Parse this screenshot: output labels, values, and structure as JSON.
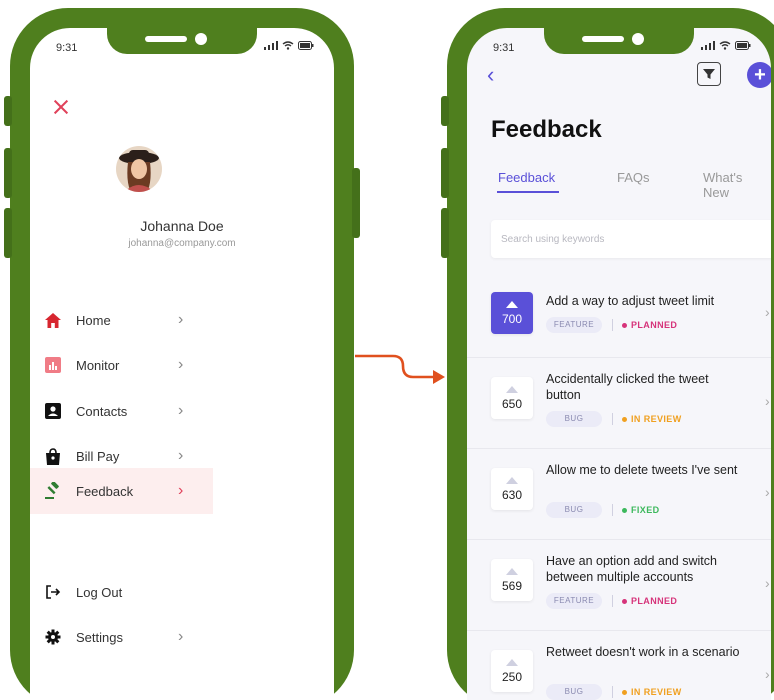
{
  "left_phone": {
    "status_time": "9:31",
    "profile": {
      "name": "Johanna Doe",
      "email": "johanna@company.com"
    },
    "menu": [
      {
        "label": "Home",
        "icon": "home-icon"
      },
      {
        "label": "Monitor",
        "icon": "bar-chart-icon"
      },
      {
        "label": "Contacts",
        "icon": "contacts-icon"
      },
      {
        "label": "Bill Pay",
        "icon": "shopping-bag-icon"
      },
      {
        "label": "Feedback",
        "icon": "gavel-icon",
        "active": true
      }
    ],
    "bottom_menu": [
      {
        "label": "Log Out",
        "icon": "logout-icon"
      },
      {
        "label": "Settings",
        "icon": "gear-icon"
      }
    ]
  },
  "right_phone": {
    "status_time": "9:31",
    "title": "Feedback",
    "tabs": [
      {
        "label": "Feedback",
        "active": true
      },
      {
        "label": "FAQs"
      },
      {
        "label": "What's New"
      }
    ],
    "search": {
      "placeholder": "Search using keywords"
    },
    "items": [
      {
        "votes": "700",
        "title": "Add a way to adjust tweet limit",
        "tag": "FEATURE",
        "status": "PLANNED",
        "status_color": "#d6337a",
        "active": true
      },
      {
        "votes": "650",
        "title": "Accidentally clicked the tweet button",
        "tag": "BUG",
        "status": "IN REVIEW",
        "status_color": "#f0a020"
      },
      {
        "votes": "630",
        "title": "Allow me to delete tweets I've sent",
        "tag": "BUG",
        "status": "FIXED",
        "status_color": "#3cb85c"
      },
      {
        "votes": "569",
        "title": "Have an option add and switch between multiple accounts",
        "tag": "FEATURE",
        "status": "PLANNED",
        "status_color": "#d6337a"
      },
      {
        "votes": "250",
        "title": "Retweet doesn't work in a scenario",
        "tag": "BUG",
        "status": "IN REVIEW",
        "status_color": "#f0a020"
      }
    ]
  },
  "colors": {
    "frame": "#4f7f1e",
    "accent": "#5a50d8",
    "close": "#e0415a",
    "connector": "#e0501e"
  }
}
